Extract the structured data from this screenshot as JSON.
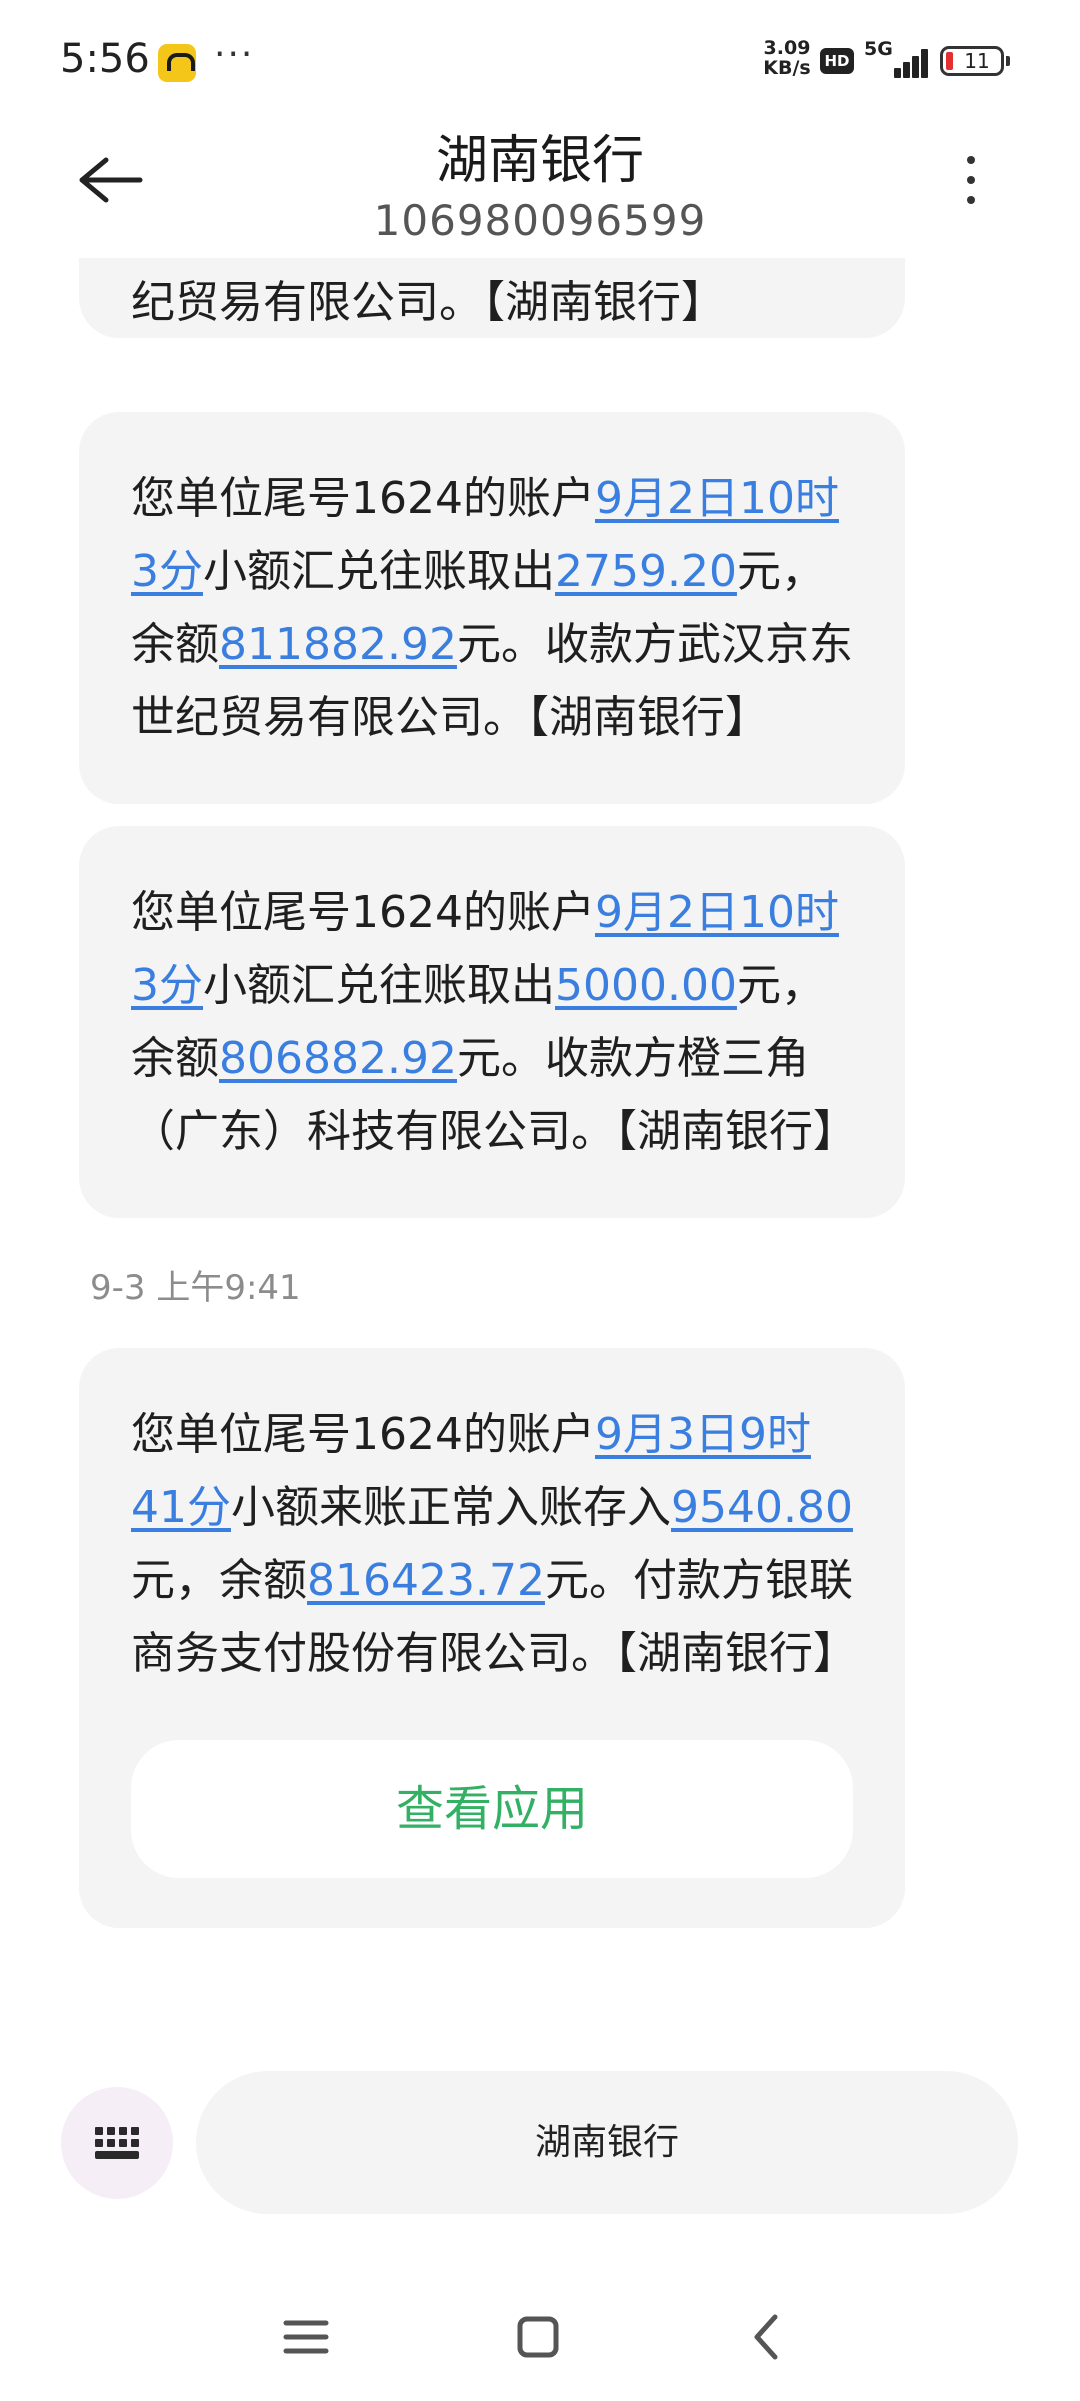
{
  "status_bar": {
    "time": "5:56",
    "more": "···",
    "network_speed": "3.09",
    "network_unit": "KB/s",
    "hd": "HD",
    "network_type": "5G",
    "battery": "11",
    "battery_color": "#e0302f",
    "app_icon_color": "#f5c61a"
  },
  "header": {
    "title": "湖南银行",
    "number": "106980096599",
    "back_icon": "arrow-left-icon",
    "menu_icon": "more-vertical-icon"
  },
  "messages": [
    {
      "text": "纪贸易有限公司。【湖南银行】"
    },
    {
      "segments": [
        {
          "t": "您单位尾号1624的账户"
        },
        {
          "t": "9月2日10时3分",
          "link": true
        },
        {
          "t": "小额汇兑往账取出"
        },
        {
          "t": "2759.20",
          "link": true
        },
        {
          "t": "元，余额"
        },
        {
          "t": "811882.92",
          "link": true
        },
        {
          "t": "元。收款方武汉京东世纪贸易有限公司。【湖南银行】"
        }
      ]
    },
    {
      "segments": [
        {
          "t": "您单位尾号1624的账户"
        },
        {
          "t": "9月2日10时3分",
          "link": true
        },
        {
          "t": "小额汇兑往账取出"
        },
        {
          "t": "5000.00",
          "link": true
        },
        {
          "t": "元，余额"
        },
        {
          "t": "806882.92",
          "link": true
        },
        {
          "t": "元。收款方橙三角（广东）科技有限公司。【湖南银行】"
        }
      ]
    },
    {
      "segments": [
        {
          "t": "您单位尾号1624的账户"
        },
        {
          "t": "9月3日9时41分",
          "link": true
        },
        {
          "t": "小额来账正常入账存入"
        },
        {
          "t": "9540.80",
          "link": true
        },
        {
          "t": "元，余额"
        },
        {
          "t": "816423.72",
          "link": true
        },
        {
          "t": "元。付款方银联商务支付股份有限公司。【湖南银行】"
        }
      ],
      "action_label": "查看应用"
    }
  ],
  "date_separator": "9-3 上午9:41",
  "input_bar": {
    "keyboard_icon": "keyboard-icon",
    "label": "湖南银行"
  },
  "nav_bar": {
    "menu_icon": "menu-icon",
    "home_icon": "home-square-icon",
    "back_icon": "back-chevron-icon"
  },
  "colors": {
    "link": "#3a7ee0",
    "action": "#33b064",
    "bubble": "#f4f4f4"
  }
}
